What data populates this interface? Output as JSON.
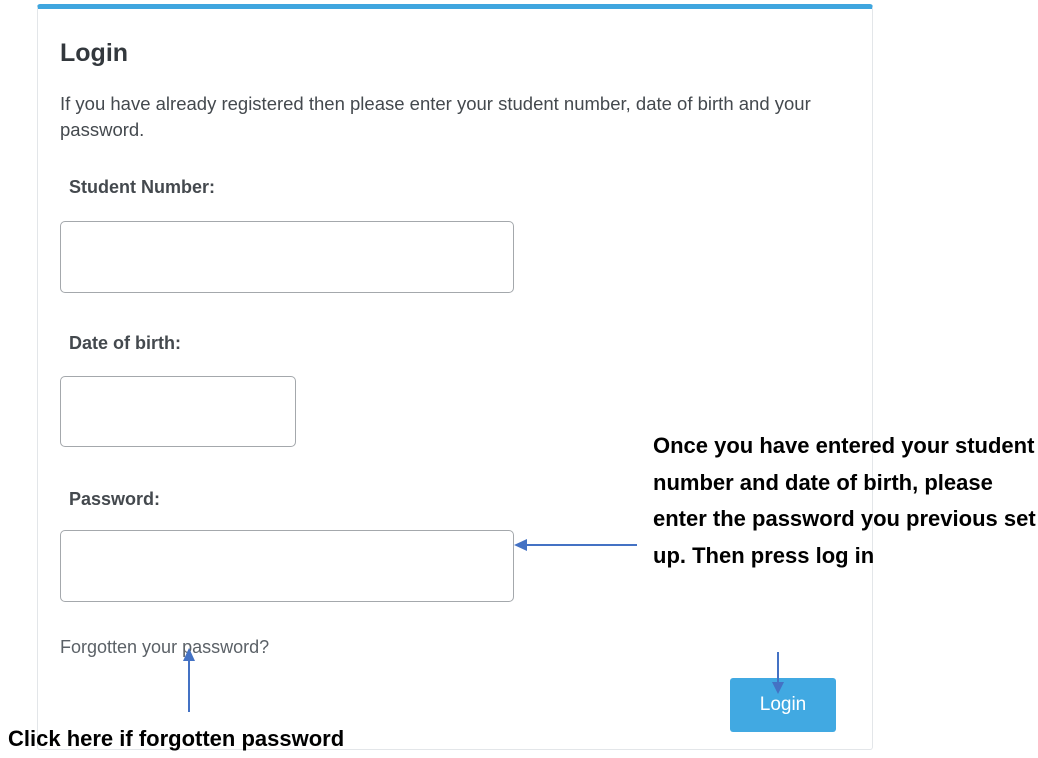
{
  "form": {
    "title": "Login",
    "intro": "If you have already registered then please enter your student number, date of birth and your password.",
    "student_number": {
      "label": "Student Number:",
      "value": "",
      "placeholder": ""
    },
    "date_of_birth": {
      "label": "Date of birth:",
      "value": "",
      "placeholder": ""
    },
    "password": {
      "label": "Password:",
      "value": "",
      "placeholder": ""
    },
    "forgot_link": "Forgotten your password?",
    "login_button": "Login"
  },
  "annotations": {
    "password_note": "Once you have entered your student number and date of birth, please enter the password you previous set up. Then press log in",
    "forgot_note": "Click here if forgotten password"
  },
  "colors": {
    "accent": "#3fa6df",
    "button": "#41a9e2",
    "arrow": "#4472c4"
  }
}
